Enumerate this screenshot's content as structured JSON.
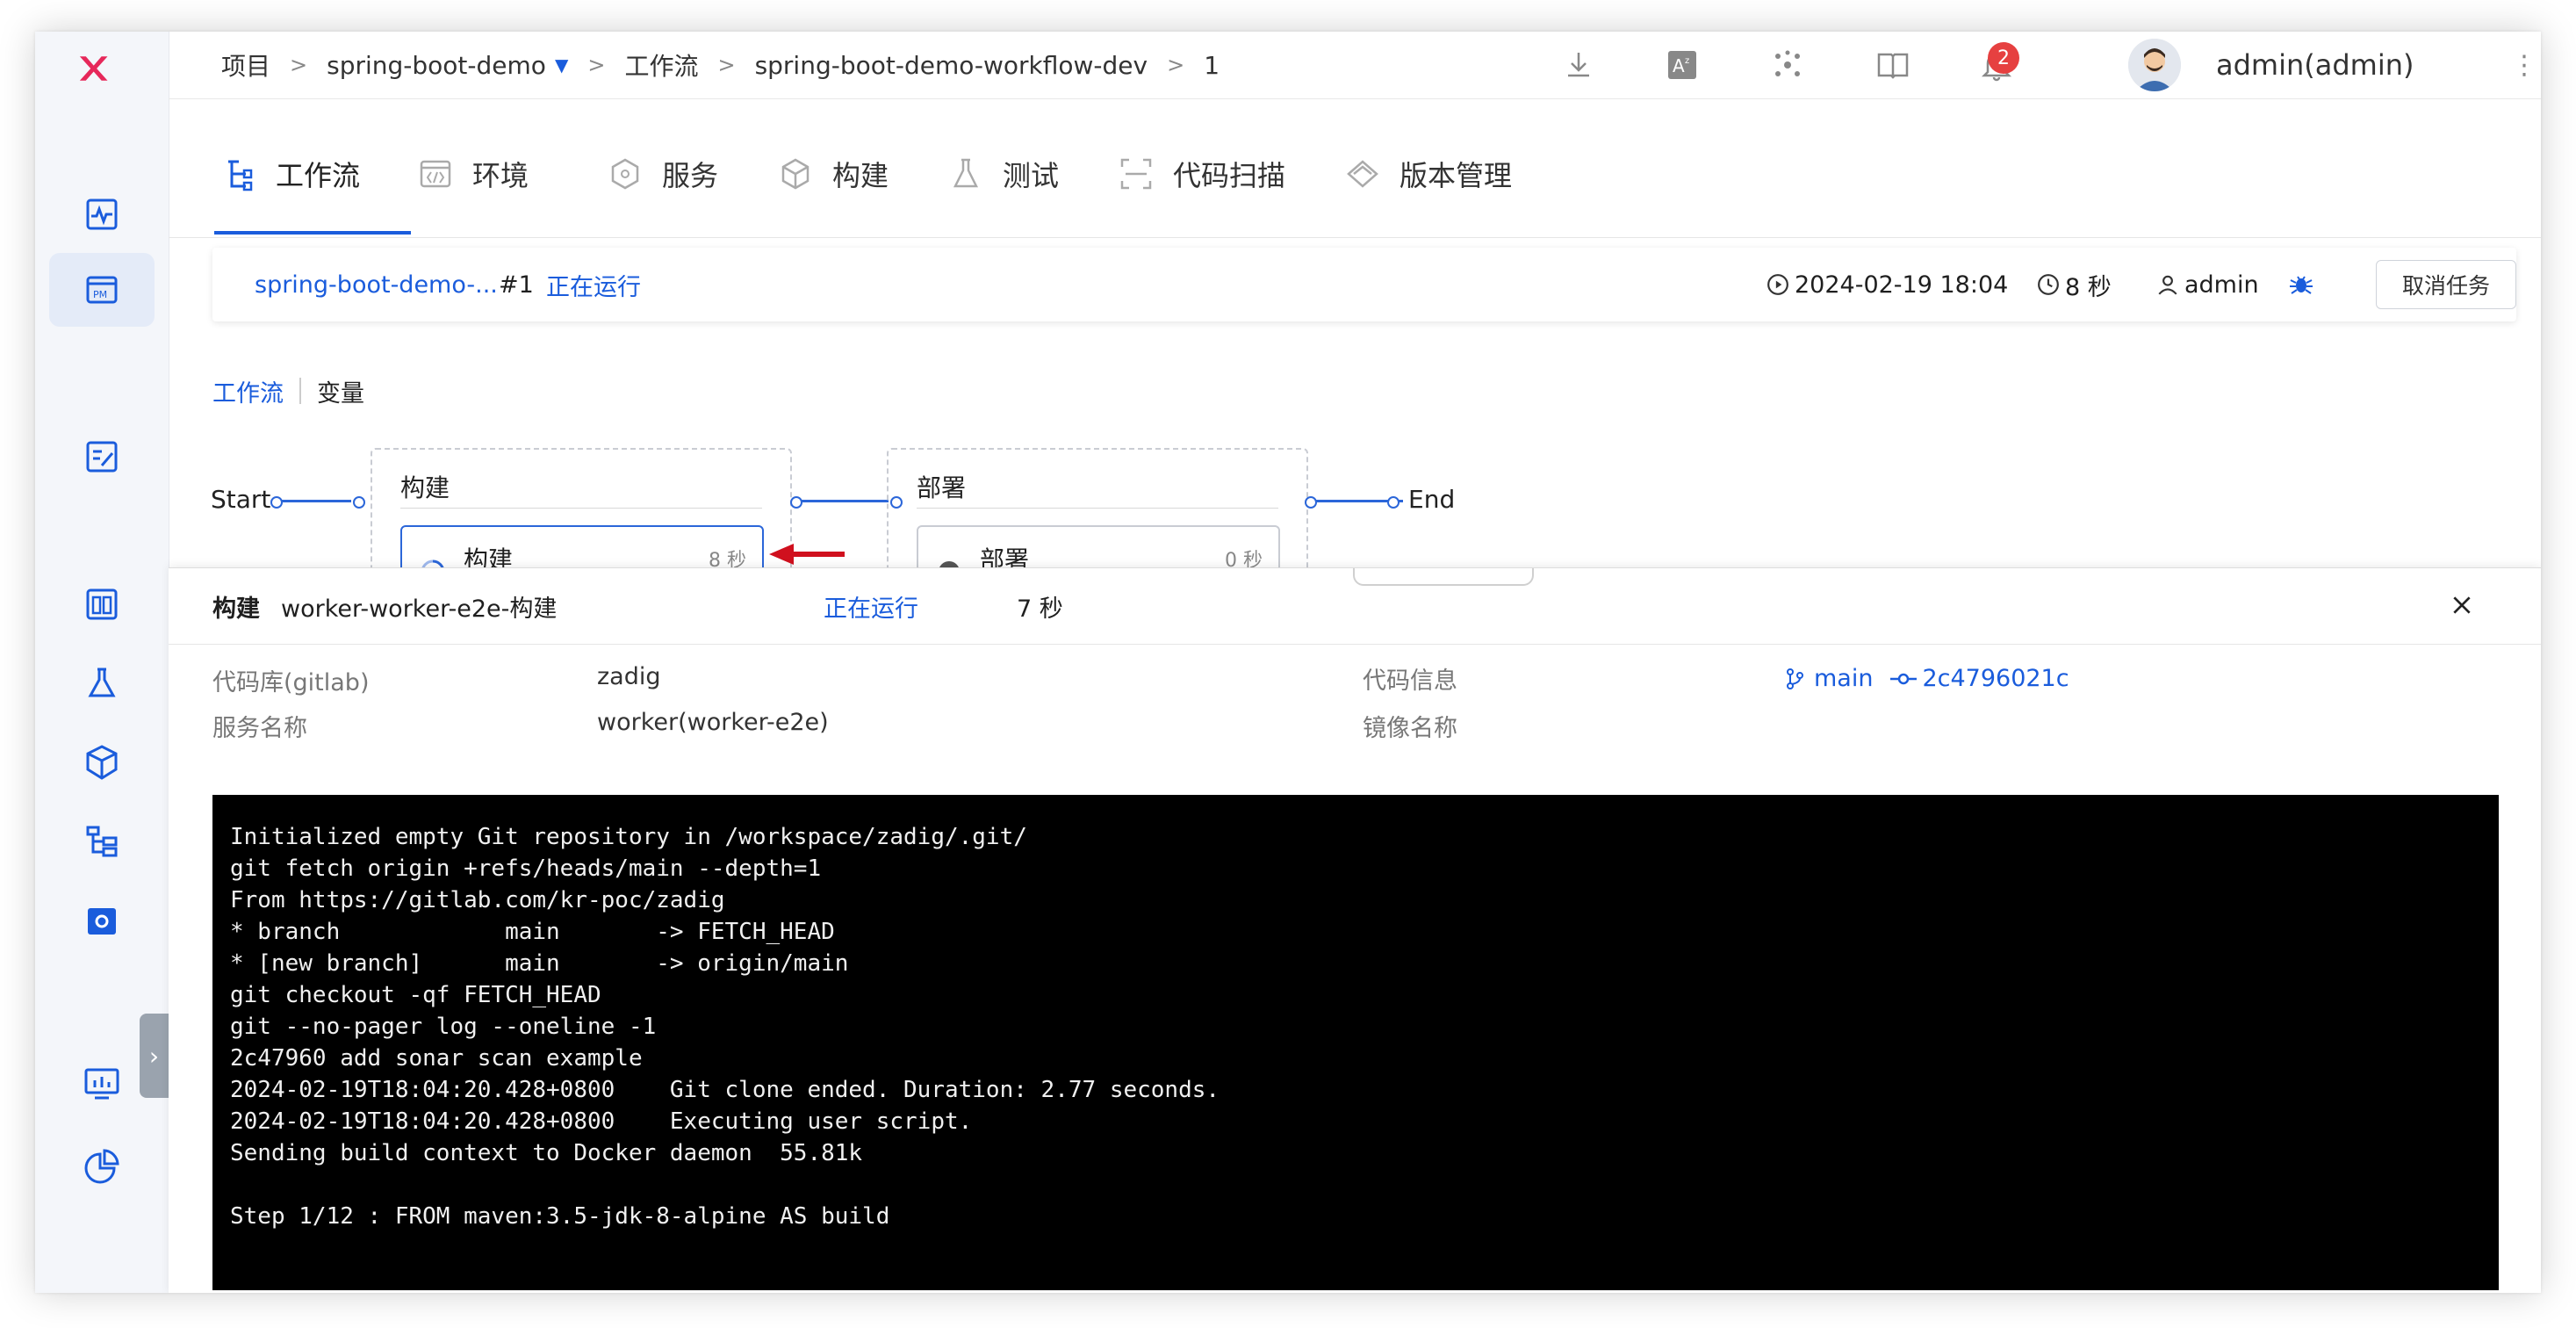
{
  "breadcrumb": {
    "items": [
      "项目",
      "spring-boot-demo",
      "工作流",
      "spring-boot-demo-workflow-dev",
      "1"
    ],
    "separator": ">"
  },
  "topbar": {
    "notification_count": "2",
    "user": "admin(admin)",
    "icons": [
      "download-icon",
      "translate-icon",
      "graph-icon",
      "book-icon",
      "bell-icon"
    ]
  },
  "tabs": [
    {
      "label": "工作流",
      "icon": "workflow-icon",
      "active": true
    },
    {
      "label": "环境",
      "icon": "environment-icon"
    },
    {
      "label": "服务",
      "icon": "service-icon"
    },
    {
      "label": "构建",
      "icon": "build-icon"
    },
    {
      "label": "测试",
      "icon": "test-icon"
    },
    {
      "label": "代码扫描",
      "icon": "scan-icon"
    },
    {
      "label": "版本管理",
      "icon": "version-icon"
    }
  ],
  "task": {
    "name": "spring-boot-demo-...",
    "number": "#1",
    "status": "正在运行",
    "start_time": "2024-02-19 18:04",
    "duration": "8 秒",
    "user": "admin",
    "cancel_label": "取消任务"
  },
  "subtabs": [
    "工作流",
    "变量"
  ],
  "pipeline": {
    "start_label": "Start",
    "end_label": "End",
    "stages": [
      {
        "title": "构建",
        "job": {
          "name": "构建",
          "duration": "8 秒",
          "status": "running"
        }
      },
      {
        "title": "部署",
        "job": {
          "name": "部署",
          "duration": "0 秒",
          "status": "pending"
        }
      }
    ]
  },
  "panel": {
    "type_label": "构建",
    "job_name": "worker-worker-e2e-构建",
    "status": "正在运行",
    "duration": "7 秒",
    "repo_label": "代码库(gitlab)",
    "repo_value": "zadig",
    "service_label": "服务名称",
    "service_value": "worker(worker-e2e)",
    "code_info_label": "代码信息",
    "branch": "main",
    "commit": "2c4796021c",
    "image_label": "镜像名称",
    "log": "Initialized empty Git repository in /workspace/zadig/.git/\ngit fetch origin +refs/heads/main --depth=1\nFrom https://gitlab.com/kr-poc/zadig\n* branch            main       -> FETCH_HEAD\n* [new branch]      main       -> origin/main\ngit checkout -qf FETCH_HEAD\ngit --no-pager log --oneline -1\n2c47960 add sonar scan example\n2024-02-19T18:04:20.428+0800    Git clone ended. Duration: 2.77 seconds.\n2024-02-19T18:04:20.428+0800    Executing user script.\nSending build context to Docker daemon  55.81k\n\nStep 1/12 : FROM maven:3.5-jdk-8-alpine AS build"
  },
  "colors": {
    "accent": "#1a5cdc",
    "logo": "#e6285a",
    "badge": "#e64040",
    "arrow": "#d0101e"
  }
}
